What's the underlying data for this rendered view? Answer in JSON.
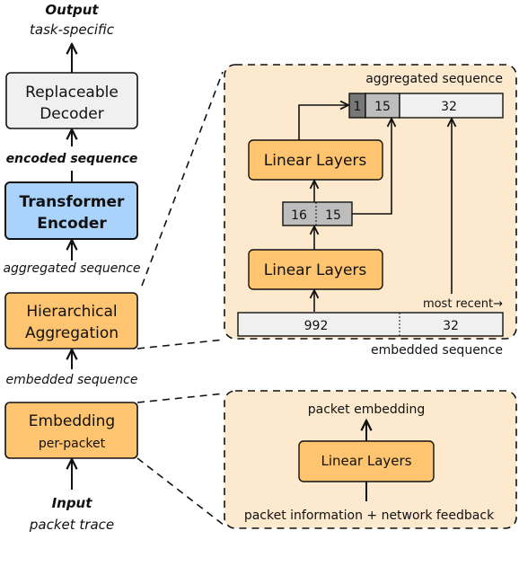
{
  "colors": {
    "orange": "#fec46f",
    "panel": "#fde9cd",
    "blue": "#a9d3fb",
    "light_gray": "#f0f0f0",
    "mid_gray": "#bdbdbd",
    "dark_gray": "#777777"
  },
  "left": {
    "output_title": "Output",
    "output_sub": "task-specific",
    "decoder_l1": "Replaceable",
    "decoder_l2": "Decoder",
    "encoded_label": "encoded sequence",
    "encoder_l1": "Transformer",
    "encoder_l2": "Encoder",
    "aggregated_label": "aggregated sequence",
    "agg_l1": "Hierarchical",
    "agg_l2": "Aggregation",
    "embedded_label": "embedded sequence",
    "emb_l1": "Embedding",
    "emb_l2": "per-packet",
    "input_title": "Input",
    "input_sub": "packet trace"
  },
  "agg_panel": {
    "top_label": "aggregated sequence",
    "agg_cells": [
      "1",
      "15",
      "32"
    ],
    "linear_upper": "Linear Layers",
    "mid_cells": [
      "16",
      "15"
    ],
    "linear_lower": "Linear Layers",
    "most_recent": "most recent→",
    "emb_cells": [
      "992",
      "32"
    ],
    "bottom_label": "embedded sequence"
  },
  "emb_panel": {
    "top_label": "packet embedding",
    "linear": "Linear Layers",
    "bottom_label": "packet information + network feedback"
  }
}
